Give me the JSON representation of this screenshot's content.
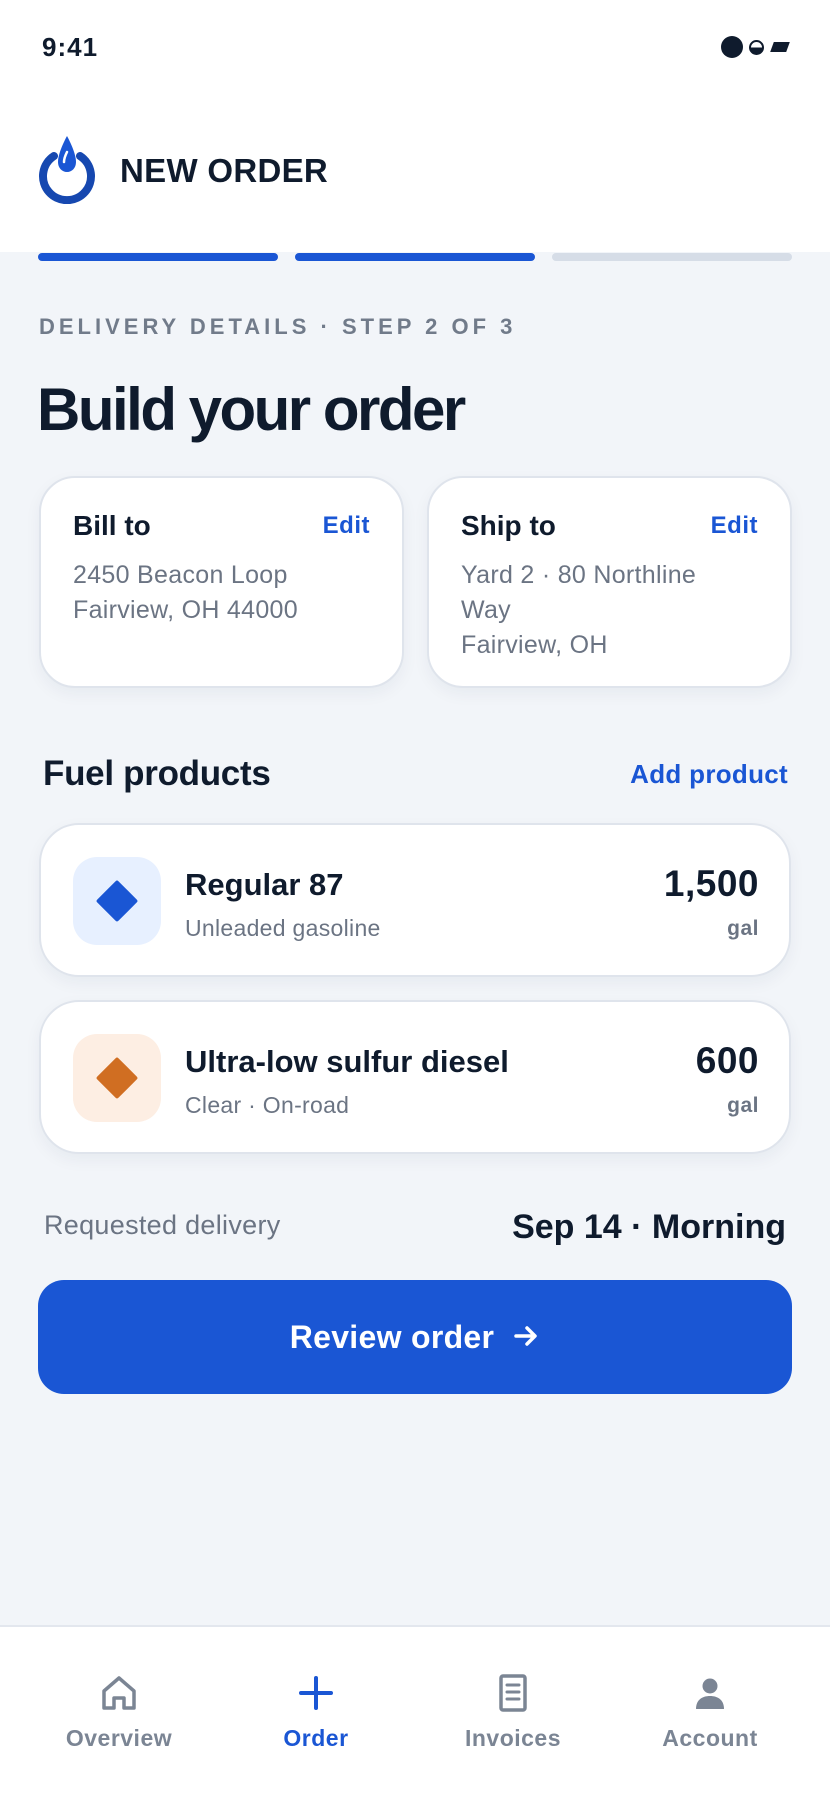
{
  "status_bar": {
    "time": "9:41"
  },
  "header": {
    "title": "NEW ORDER",
    "logo_icon": "droplet-power-icon",
    "progress": {
      "total_steps": 3,
      "completed_steps": 2
    }
  },
  "step": {
    "label": "DELIVERY DETAILS · STEP 2 OF 3"
  },
  "page": {
    "title": "Build your order"
  },
  "bill_to": {
    "title": "Bill to",
    "edit_label": "Edit",
    "lines": [
      "2450 Beacon Loop",
      "Fairview, OH 44000"
    ]
  },
  "ship_to": {
    "title": "Ship to",
    "edit_label": "Edit",
    "lines": [
      "Yard 2 · 80 Northline",
      "Way",
      "Fairview, OH"
    ]
  },
  "products_section": {
    "title": "Fuel products",
    "add_label": "Add product"
  },
  "products": [
    {
      "name": "Regular 87",
      "description": "Unleaded gasoline",
      "quantity": "1,500",
      "unit": "gal",
      "icon": "diamond-icon",
      "color": "#1a56d4"
    },
    {
      "name": "Ultra-low sulfur diesel",
      "description": "Clear · On-road",
      "quantity": "600",
      "unit": "gal",
      "icon": "diamond-icon",
      "color": "#d06e22"
    }
  ],
  "delivery": {
    "label": "Requested delivery",
    "value": "Sep 14 · Morning"
  },
  "cta": {
    "label": "Review order",
    "icon": "arrow-right-icon"
  },
  "tabs": [
    {
      "label": "Overview",
      "icon": "home-icon",
      "active": false
    },
    {
      "label": "Order",
      "icon": "plus-icon",
      "active": true
    },
    {
      "label": "Invoices",
      "icon": "document-icon",
      "active": false
    },
    {
      "label": "Account",
      "icon": "person-icon",
      "active": false
    }
  ],
  "colors": {
    "accent": "#1a56d4",
    "background": "#f2f5f9",
    "text": "#0f1b2d",
    "muted": "#6b7483"
  }
}
